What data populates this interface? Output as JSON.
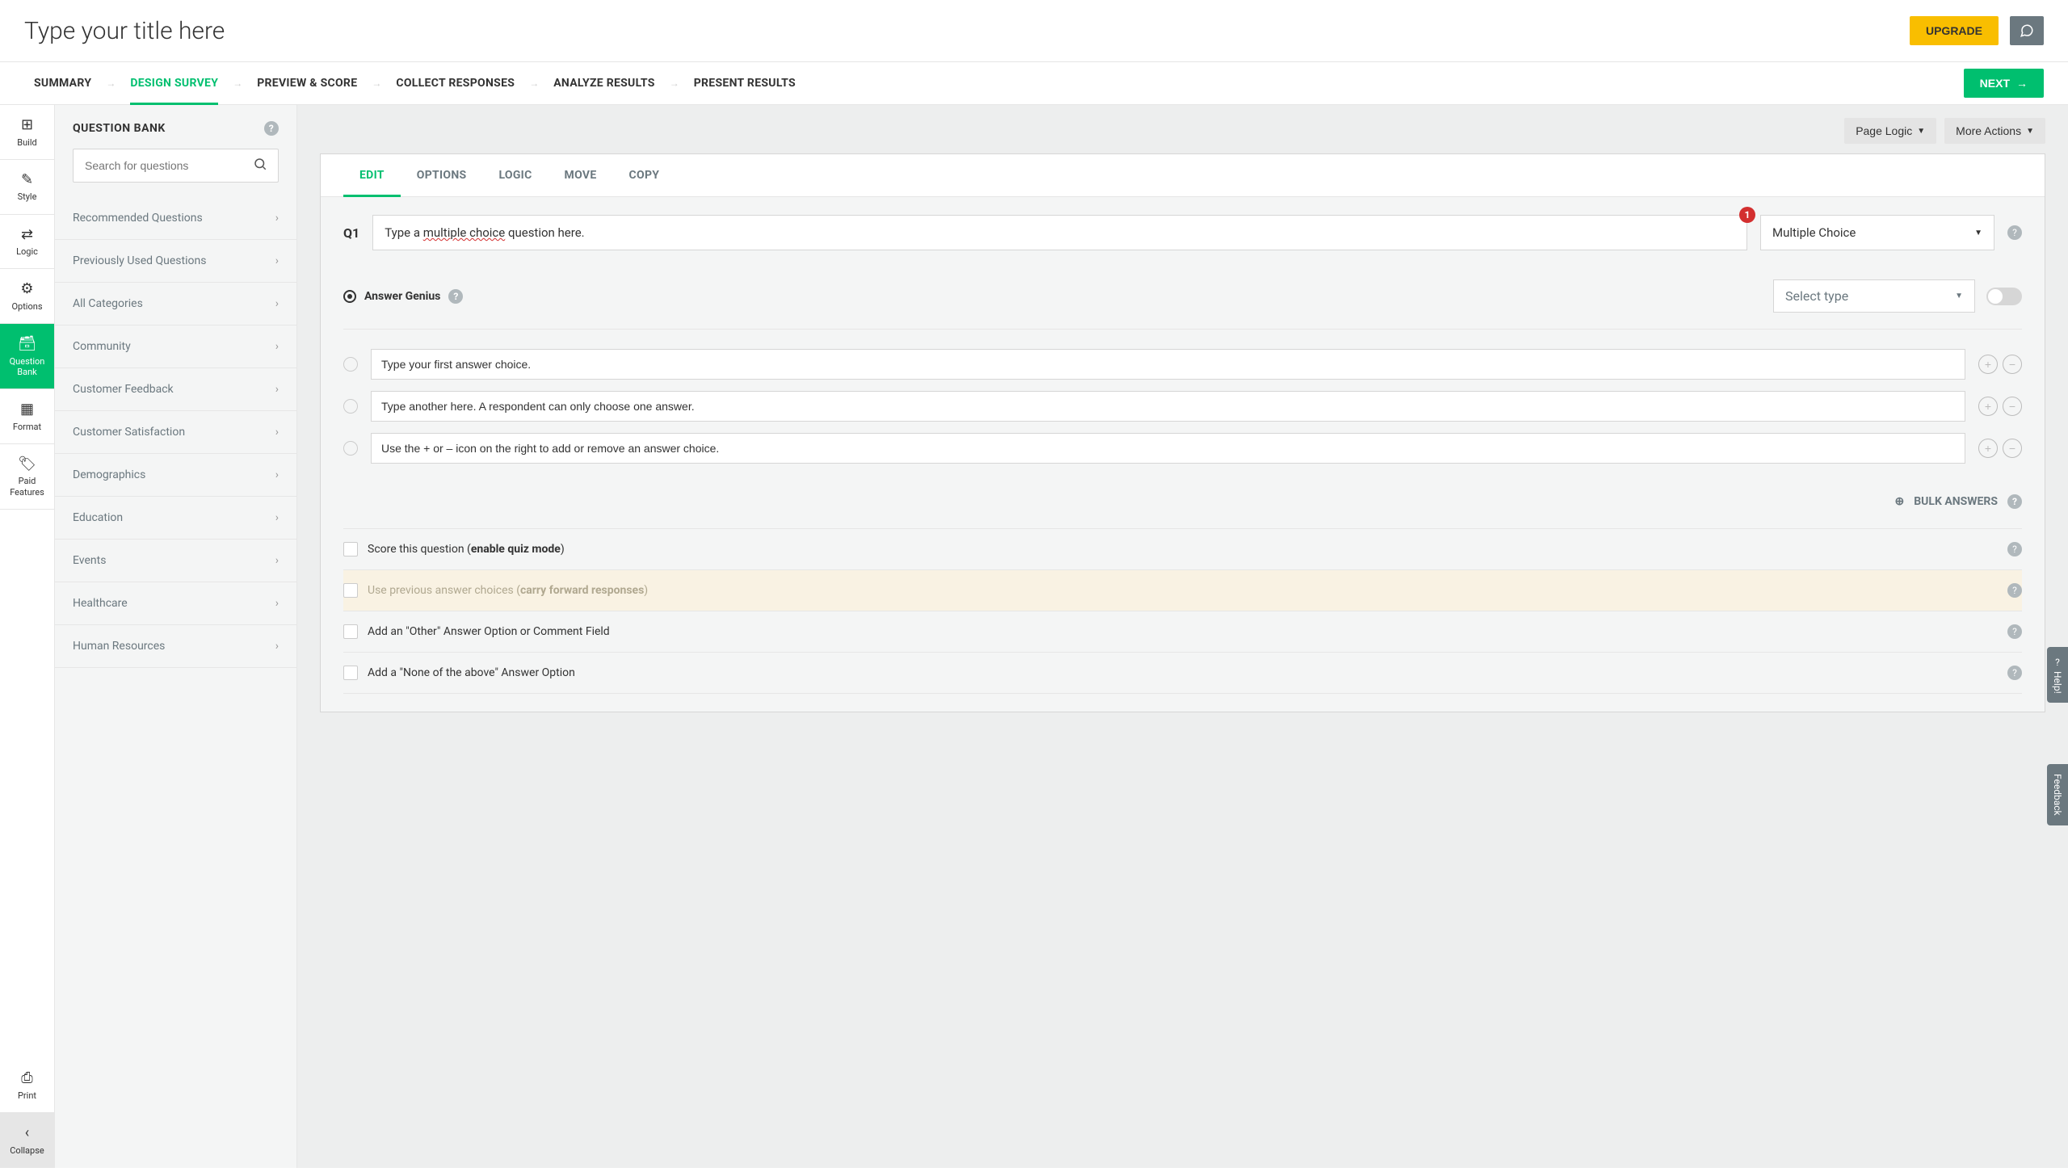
{
  "header": {
    "title": "Type your title here",
    "upgrade": "UPGRADE"
  },
  "nav": {
    "items": [
      "SUMMARY",
      "DESIGN SURVEY",
      "PREVIEW & SCORE",
      "COLLECT RESPONSES",
      "ANALYZE RESULTS",
      "PRESENT RESULTS"
    ],
    "active_index": 1,
    "next": "NEXT"
  },
  "rail": {
    "items": [
      {
        "label": "Build",
        "icon": "⊞"
      },
      {
        "label": "Style",
        "icon": "✎"
      },
      {
        "label": "Logic",
        "icon": "⇄"
      },
      {
        "label": "Options",
        "icon": "⚙"
      },
      {
        "label": "Question Bank",
        "icon": "🗃"
      },
      {
        "label": "Format",
        "icon": "▦"
      },
      {
        "label": "Paid Features",
        "icon": "🏷"
      }
    ],
    "active_index": 4,
    "print": "Print",
    "collapse": "Collapse"
  },
  "sidebar": {
    "title": "QUESTION BANK",
    "search_placeholder": "Search for questions",
    "categories": [
      "Recommended Questions",
      "Previously Used Questions",
      "All Categories",
      "Community",
      "Customer Feedback",
      "Customer Satisfaction",
      "Demographics",
      "Education",
      "Events",
      "Healthcare",
      "Human Resources"
    ]
  },
  "canvas": {
    "page_logic": "Page Logic",
    "more_actions": "More Actions"
  },
  "question": {
    "tabs": [
      "EDIT",
      "OPTIONS",
      "LOGIC",
      "MOVE",
      "COPY"
    ],
    "active_tab": 0,
    "number": "Q1",
    "prompt_prefix": "Type a ",
    "prompt_underlined": "multiple choice",
    "prompt_suffix": " question here.",
    "error_count": "1",
    "type_label": "Multiple Choice",
    "genius_label": "Answer Genius",
    "genius_select_placeholder": "Select type",
    "answers": [
      "Type your first answer choice.",
      "Type another here. A respondent can only choose one answer.",
      "Use the + or – icon on the right to add or remove an answer choice."
    ],
    "bulk_label": "BULK ANSWERS",
    "options": [
      {
        "prefix": "Score this question (",
        "bold": "enable quiz mode",
        "suffix": ")",
        "muted": false
      },
      {
        "prefix": "Use previous answer choices (",
        "bold": "carry forward responses",
        "suffix": ")",
        "muted": true
      },
      {
        "prefix": "Add an \"Other\" Answer Option or Comment Field",
        "bold": "",
        "suffix": "",
        "muted": false
      },
      {
        "prefix": "Add a \"None of the above\" Answer Option",
        "bold": "",
        "suffix": "",
        "muted": false
      }
    ]
  },
  "float": {
    "help": "Help!",
    "feedback": "Feedback"
  }
}
